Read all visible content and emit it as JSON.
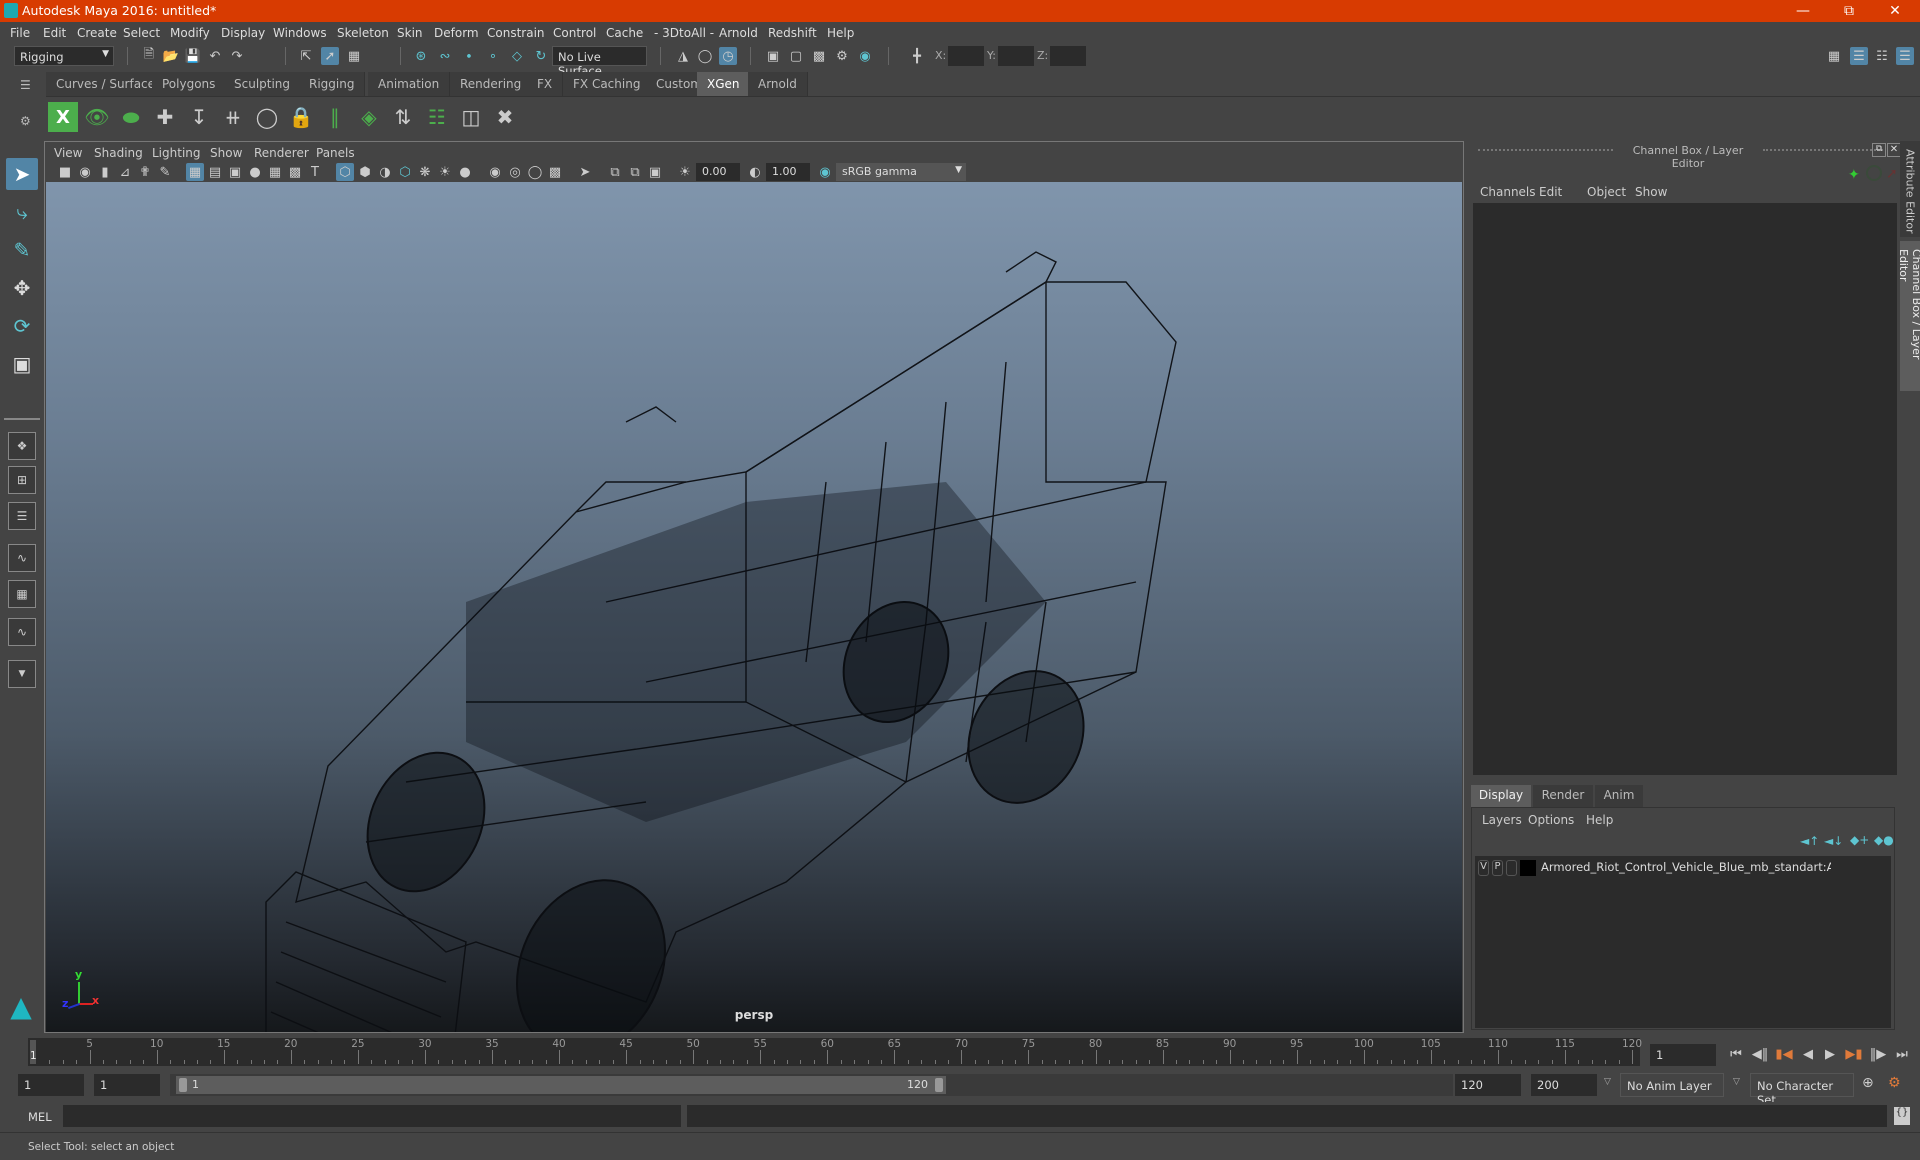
{
  "window": {
    "title": "Autodesk Maya 2016: untitled*",
    "controls": [
      "minimize",
      "restore",
      "close"
    ]
  },
  "menubar": [
    "File",
    "Edit",
    "Create",
    "Select",
    "Modify",
    "Display",
    "Windows",
    "Skeleton",
    "Skin",
    "Deform",
    "Constrain",
    "Control",
    "Cache",
    "- 3DtoAll -",
    "Arnold",
    "Redshift",
    "Help"
  ],
  "status_line": {
    "menu_set": "Rigging",
    "live_surface": "No Live Surface",
    "xyz_labels": [
      "X:",
      "Y:",
      "Z:"
    ]
  },
  "shelf": {
    "tabs": [
      "Curves / Surfaces",
      "Polygons",
      "Sculpting",
      "Rigging",
      "Animation",
      "Rendering",
      "FX",
      "FX Caching",
      "Custom",
      "XGen",
      "Arnold"
    ],
    "active_tab": "XGen",
    "icons": [
      "xgen-editor-icon",
      "toggle-visibility-icon",
      "hide-icon",
      "add-guide-icon",
      "move-guide-icon",
      "guide-tool-a-icon",
      "guide-tool-b-icon",
      "guide-tool-c-icon",
      "guide-tool-d-icon",
      "density-icon",
      "sculpt-guides-icon",
      "select-guides-icon",
      "guide-tool-e-icon",
      "delete-guides-icon"
    ]
  },
  "viewport": {
    "menu": [
      "View",
      "Shading",
      "Lighting",
      "Show",
      "Renderer",
      "Panels"
    ],
    "exposure": "0.00",
    "gamma": "1.00",
    "color_space": "sRGB gamma",
    "camera_label": "persp",
    "axis": {
      "x": "x",
      "y": "y",
      "z": "z"
    }
  },
  "channel_box": {
    "title": "Channel Box / Layer Editor",
    "menu": [
      "Channels",
      "Edit",
      "Object",
      "Show"
    ]
  },
  "layer_editor": {
    "tabs": [
      "Display",
      "Render",
      "Anim"
    ],
    "active_tab": "Display",
    "menu": [
      "Layers",
      "Options",
      "Help"
    ],
    "layers": [
      {
        "visible": "V",
        "playback": "P",
        "color": "#000000",
        "name": "Armored_Riot_Control_Vehicle_Blue_mb_standart:Armore"
      }
    ]
  },
  "side_tabs": [
    "Attribute Editor",
    "Channel Box / Layer Editor"
  ],
  "time_slider": {
    "ticks": [
      5,
      10,
      15,
      20,
      25,
      30,
      35,
      40,
      45,
      50,
      55,
      60,
      65,
      70,
      75,
      80,
      85,
      90,
      95,
      100,
      105,
      110,
      115,
      120
    ],
    "current_frame": "1",
    "current_frame_field": "1"
  },
  "range_slider": {
    "start_time": "1",
    "playback_start": "1",
    "range_start_label": "1",
    "range_end_label": "120",
    "playback_end": "120",
    "end_time": "200",
    "anim_layer": "No Anim Layer",
    "character_set": "No Character Set"
  },
  "command_line": {
    "label": "MEL",
    "value": ""
  },
  "help_line": "Select Tool: select an object",
  "colors": {
    "titlebar": "#d83b01",
    "accent": "#5285a6",
    "maya_teal": "#1fa8b0",
    "xgen_green": "#4cae4c"
  }
}
